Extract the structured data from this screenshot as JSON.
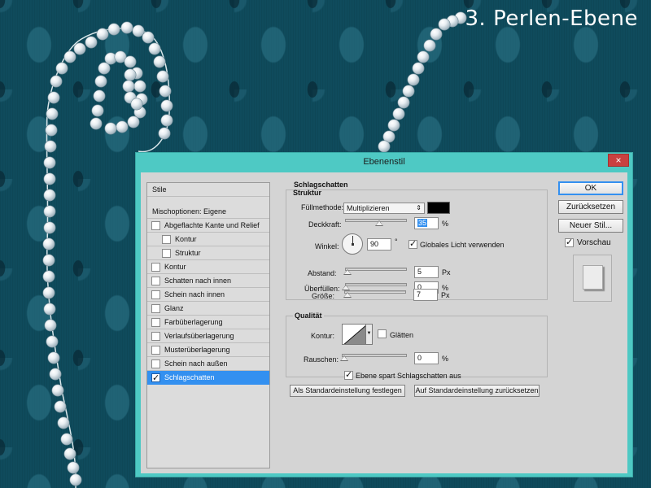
{
  "headline": "3. Perlen-Ebene",
  "dialog": {
    "title": "Ebenenstil",
    "close_label": "×",
    "styles_list": {
      "header": "Stile",
      "blend_options": "Mischoptionen: Eigene",
      "items": [
        {
          "label": "Abgeflachte Kante und Relief",
          "checked": false,
          "indent": false
        },
        {
          "label": "Kontur",
          "checked": false,
          "indent": true
        },
        {
          "label": "Struktur",
          "checked": false,
          "indent": true
        },
        {
          "label": "Kontur",
          "checked": false,
          "indent": false
        },
        {
          "label": "Schatten nach innen",
          "checked": false,
          "indent": false
        },
        {
          "label": "Schein nach innen",
          "checked": false,
          "indent": false
        },
        {
          "label": "Glanz",
          "checked": false,
          "indent": false
        },
        {
          "label": "Farbüberlagerung",
          "checked": false,
          "indent": false
        },
        {
          "label": "Verlaufsüberlagerung",
          "checked": false,
          "indent": false
        },
        {
          "label": "Musterüberlagerung",
          "checked": false,
          "indent": false
        },
        {
          "label": "Schein nach außen",
          "checked": false,
          "indent": false
        },
        {
          "label": "Schlagschatten",
          "checked": true,
          "indent": false,
          "selected": true
        }
      ]
    },
    "drop_shadow": {
      "section_title": "Schlagschatten",
      "structure_title": "Struktur",
      "blend_mode_label": "Füllmethode:",
      "blend_mode_value": "Multiplizieren",
      "shadow_color": "#000000",
      "opacity_label": "Deckkraft:",
      "opacity_value": "35",
      "opacity_unit": "%",
      "angle_label": "Winkel:",
      "angle_value": "90",
      "angle_unit": "°",
      "global_light_label": "Globales Licht verwenden",
      "global_light_checked": true,
      "distance_label": "Abstand:",
      "distance_value": "5",
      "distance_unit": "Px",
      "spread_label": "Überfüllen:",
      "spread_value": "0",
      "spread_unit": "%",
      "size_label": "Größe:",
      "size_value": "7",
      "size_unit": "Px",
      "quality_title": "Qualität",
      "contour_label": "Kontur:",
      "antialias_label": "Glätten",
      "antialias_checked": false,
      "noise_label": "Rauschen:",
      "noise_value": "0",
      "noise_unit": "%",
      "knockout_label": "Ebene spart Schlagschatten aus",
      "knockout_checked": true,
      "make_default_label": "Als Standardeinstellung festlegen",
      "reset_default_label": "Auf Standardeinstellung zurücksetzen"
    },
    "buttons": {
      "ok": "OK",
      "reset": "Zurücksetzen",
      "new_style": "Neuer Stil...",
      "preview_label": "Vorschau",
      "preview_checked": true
    }
  }
}
